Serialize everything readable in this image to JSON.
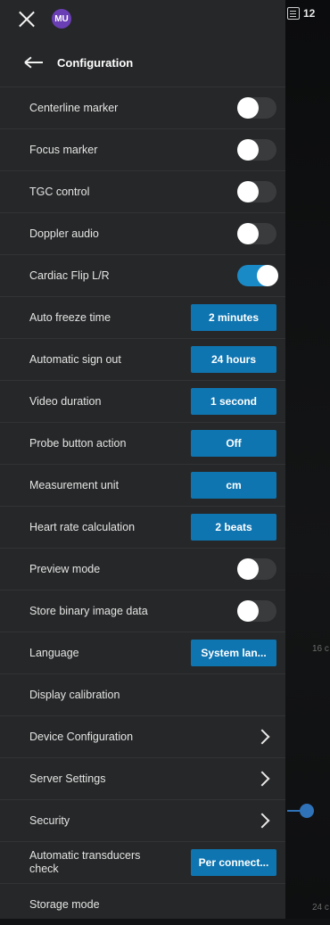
{
  "topbar": {
    "avatar_initials": "MU"
  },
  "header": {
    "title": "Configuration"
  },
  "image_area": {
    "top_counter": "12",
    "depth_labels": [
      "16 c",
      "24 c"
    ]
  },
  "settings": [
    {
      "label": "Centerline marker",
      "control": "toggle",
      "on": false
    },
    {
      "label": "Focus marker",
      "control": "toggle",
      "on": false
    },
    {
      "label": "TGC control",
      "control": "toggle",
      "on": false
    },
    {
      "label": "Doppler audio",
      "control": "toggle",
      "on": false
    },
    {
      "label": "Cardiac Flip L/R",
      "control": "toggle",
      "on": true
    },
    {
      "label": "Auto freeze time",
      "control": "button",
      "value": "2 minutes"
    },
    {
      "label": "Automatic sign out",
      "control": "button",
      "value": "24 hours"
    },
    {
      "label": "Video duration",
      "control": "button",
      "value": "1 second"
    },
    {
      "label": "Probe button action",
      "control": "button",
      "value": "Off"
    },
    {
      "label": "Measurement unit",
      "control": "button",
      "value": "cm"
    },
    {
      "label": "Heart rate calculation",
      "control": "button",
      "value": "2 beats"
    },
    {
      "label": "Preview mode",
      "control": "toggle",
      "on": false
    },
    {
      "label": "Store binary image data",
      "control": "toggle",
      "on": false
    },
    {
      "label": "Language",
      "control": "button",
      "value": "System lan..."
    },
    {
      "label": "Display calibration",
      "control": "none"
    },
    {
      "label": "Device Configuration",
      "control": "chevron"
    },
    {
      "label": "Server Settings",
      "control": "chevron"
    },
    {
      "label": "Security",
      "control": "chevron"
    },
    {
      "label": "Automatic transducers check",
      "control": "button",
      "value": "Per connect..."
    },
    {
      "label": "Storage mode",
      "control": "none"
    }
  ],
  "colors": {
    "panel": "#262728",
    "accent": "#0f75b1",
    "toggle_on": "#1a8ac6",
    "avatar": "#6a3fb5"
  }
}
